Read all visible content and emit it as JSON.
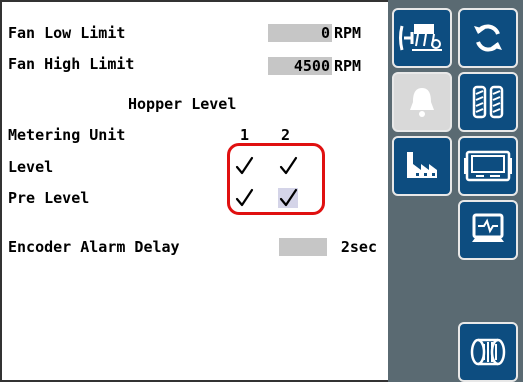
{
  "settings": {
    "fan_low_limit": {
      "label": "Fan Low Limit",
      "value": "0",
      "unit": "RPM"
    },
    "fan_high_limit": {
      "label": "Fan High Limit",
      "value": "4500",
      "unit": "RPM"
    },
    "hopper_level_heading": "Hopper Level",
    "metering_unit": {
      "label": "Metering Unit",
      "columns": [
        "1",
        "2"
      ]
    },
    "level": {
      "label": "Level",
      "unit1": true,
      "unit2": true
    },
    "pre_level": {
      "label": "Pre Level",
      "unit1": true,
      "unit2": true
    },
    "encoder_alarm_delay": {
      "label": "Encoder Alarm Delay",
      "value": "2sec"
    }
  },
  "sidebar": {
    "buttons": [
      {
        "name": "seeder-implement-icon",
        "enabled": true
      },
      {
        "name": "refresh-cycle-icon",
        "enabled": true
      },
      {
        "name": "bell-alarm-icon",
        "enabled": false
      },
      {
        "name": "tire-tread-icon",
        "enabled": true
      },
      {
        "name": "factory-icon",
        "enabled": true
      },
      {
        "name": "display-terminal-icon",
        "enabled": true
      },
      {
        "name": "monitor-diagnostics-icon",
        "enabled": true
      },
      {
        "name": "metering-roller-icon",
        "enabled": true
      }
    ]
  },
  "colors": {
    "button_blue": "#0d4d80",
    "sidebar_gray": "#5a6a72",
    "field_gray": "#c6c6c6",
    "highlight_red": "#e01010"
  }
}
